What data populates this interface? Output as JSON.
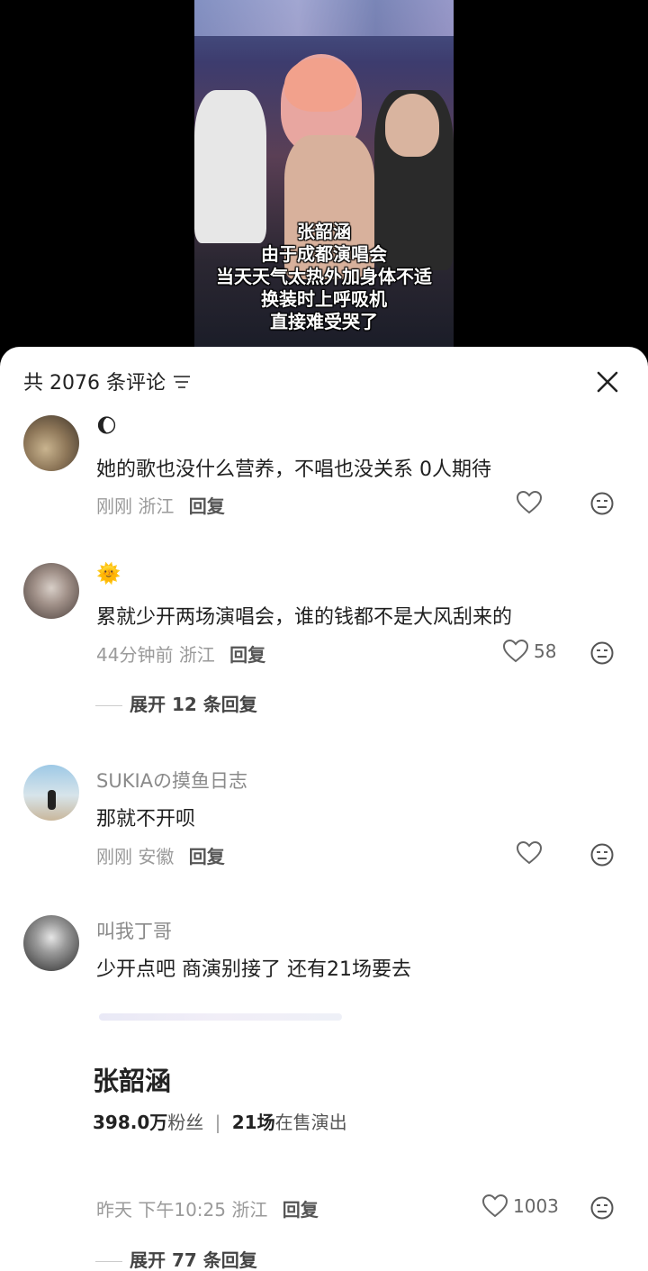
{
  "video": {
    "subtitle_lines": [
      "张韶涵",
      "由于成都演唱会",
      "当天天气太热外加身体不适",
      "换装时上呼吸机",
      "直接难受哭了"
    ]
  },
  "header": {
    "count_label": "共 2076 条评论",
    "icons": {
      "filter": "filter-lines-icon",
      "close": "close-icon"
    }
  },
  "comments": [
    {
      "username": "🌔",
      "text": "她的歌也没什么营养，不唱也没关系 0人期待",
      "time": "刚刚",
      "location": "浙江",
      "reply_label": "回复",
      "likes": ""
    },
    {
      "username": "🌞",
      "text": "累就少开两场演唱会，谁的钱都不是大风刮来的",
      "time": "44分钟前",
      "location": "浙江",
      "reply_label": "回复",
      "likes": "58",
      "expand_label": "展开 12 条回复"
    },
    {
      "username": "SUKIAの摸鱼日志",
      "text": "那就不开呗",
      "time": "刚刚",
      "location": "安徽",
      "reply_label": "回复",
      "likes": ""
    },
    {
      "username": "叫我丁哥",
      "text": "少开点吧 商演别接了 还有21场要去",
      "card": {
        "title": "张韶涵",
        "fans_value": "398.0万",
        "fans_label": "粉丝",
        "shows_value": "21场",
        "shows_label": "在售演出"
      },
      "time": "昨天 下午10:25",
      "location": "浙江",
      "reply_label": "回复",
      "likes": "1003",
      "expand_label": "展开 77 条回复"
    }
  ],
  "colors": {
    "sheet_bg": "#ffffff",
    "meta_text": "#9a9a9a",
    "primary_text": "#1f1f1f"
  }
}
